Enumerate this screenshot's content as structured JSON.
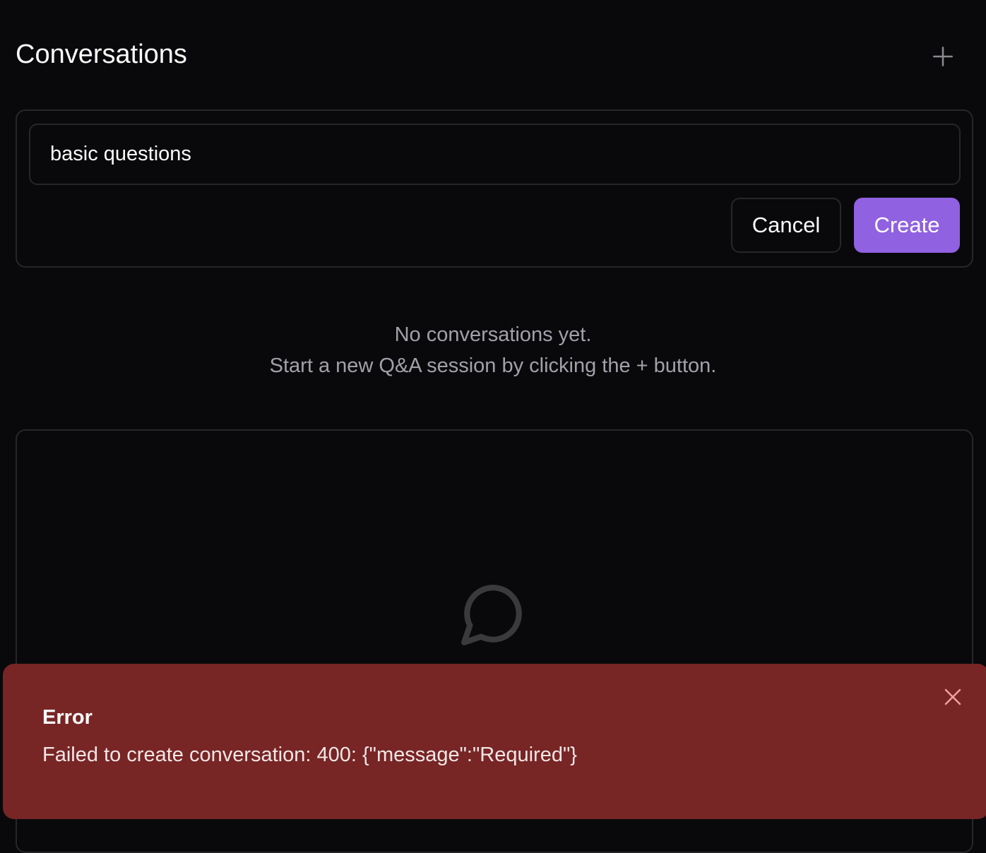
{
  "header": {
    "title": "Conversations",
    "new_icon": "plus-icon"
  },
  "form": {
    "input_value": "basic questions",
    "cancel_label": "Cancel",
    "create_label": "Create"
  },
  "empty": {
    "line1": "No conversations yet.",
    "line2": "Start a new Q&A session by clicking the + button."
  },
  "panel": {
    "icon": "message-circle-icon"
  },
  "toast": {
    "title": "Error",
    "message": "Failed to create conversation: 400: {\"message\":\"Required\"}"
  },
  "colors": {
    "accent": "#9061e0",
    "toast_bg": "#772525",
    "background": "#09090b"
  }
}
